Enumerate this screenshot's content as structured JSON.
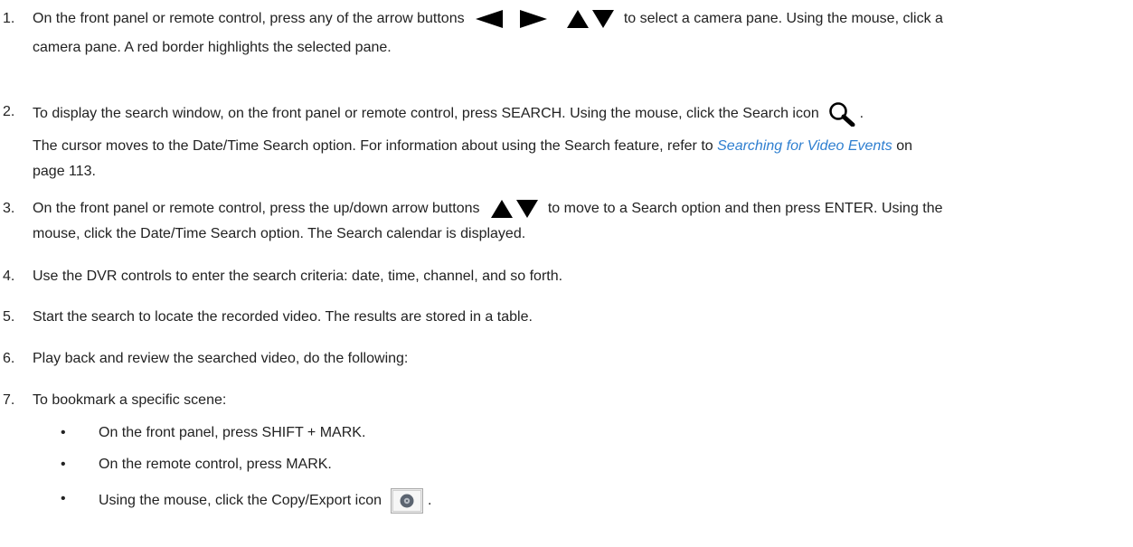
{
  "steps": [
    {
      "num": "1.",
      "part1": "On the front panel or remote control, press any of the arrow buttons",
      "part2": "to select a camera pane. Using the mouse, click a",
      "line2": "camera pane. A red border highlights the selected pane."
    },
    {
      "num": "2.",
      "part1": "To display the search window, on the front panel or remote control, press SEARCH. Using the mouse, click the Search icon",
      "part1_end": ".",
      "line2": "The cursor moves to the Date/Time Search option. For information about using the Search feature, refer to",
      "link": "Searching for Video Events",
      "line2_end": "on",
      "line3": "page 113."
    },
    {
      "num": "3.",
      "part1": "On the front panel or remote control, press the up/down arrow buttons",
      "part2": "to move to a Search option and then press ENTER. Using the",
      "line2": "mouse, click the Date/Time Search option. The Search calendar is displayed."
    },
    {
      "num": "4.",
      "text": "Use the DVR controls to enter the search criteria: date, time, channel, and so forth."
    },
    {
      "num": "5.",
      "text": "Start the search to locate the recorded video. The results are stored in a table."
    },
    {
      "num": "6.",
      "text": "Play back and review the searched video, do the following:"
    },
    {
      "num": "7.",
      "text": "To bookmark a specific scene:",
      "bullets": [
        "On the front panel, press SHIFT + MARK.",
        "On the remote control, press MARK.",
        "Using the mouse, click the Copy/Export icon"
      ],
      "bullet_char": "•",
      "last_bullet_end": "."
    }
  ],
  "icons": {
    "arrow_left": "left-arrow-icon",
    "arrow_right": "right-arrow-icon",
    "arrow_up": "up-arrow-icon",
    "arrow_down": "down-arrow-icon",
    "search": "search-icon",
    "copy_export": "copy-export-icon"
  },
  "colors": {
    "text": "#222222",
    "link": "#2f7fd0"
  }
}
